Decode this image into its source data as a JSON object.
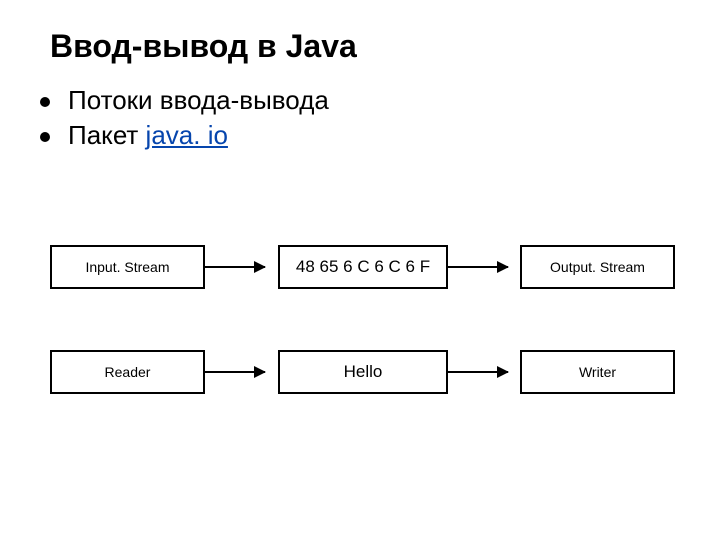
{
  "title": "Ввод-вывод в Java",
  "bullets": {
    "b1": "Потоки ввода-вывода",
    "b2_prefix": "Пакет ",
    "b2_link": "java. io"
  },
  "diagram": {
    "row1": {
      "left": "Input. Stream",
      "mid": "48 65 6 C 6 C 6 F",
      "right": "Output. Stream"
    },
    "row2": {
      "left": "Reader",
      "mid": "Hello",
      "right": "Writer"
    }
  }
}
